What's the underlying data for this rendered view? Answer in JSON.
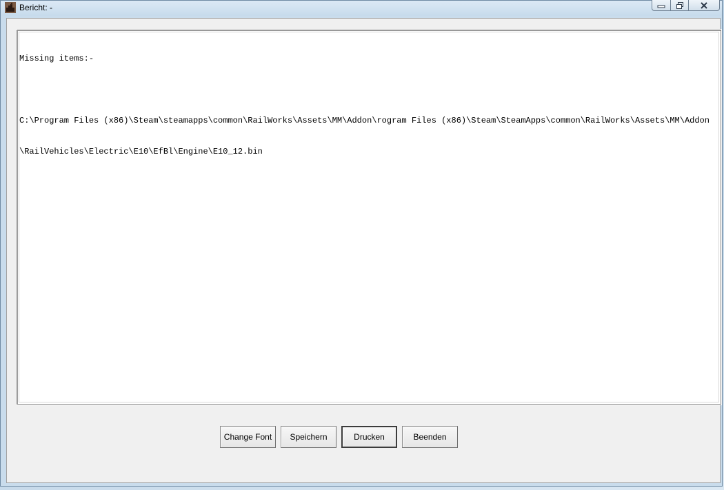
{
  "window": {
    "title": "Bericht: -",
    "icon": "app-icon",
    "controls": {
      "minimize": "minimize-icon",
      "maximize": "maximize-icon",
      "close": "close-icon"
    }
  },
  "report": {
    "lines": [
      "Missing items:-",
      "",
      "C:\\Program Files (x86)\\Steam\\steamapps\\common\\RailWorks\\Assets\\MM\\Addon\\rogram Files (x86)\\Steam\\SteamApps\\common\\RailWorks\\Assets\\MM\\Addon",
      "\\RailVehicles\\Electric\\E10\\EfBl\\Engine\\E10_12.bin"
    ]
  },
  "buttons": {
    "change_font": "Change Font",
    "save": "Speichern",
    "print": "Drucken",
    "exit": "Beenden"
  }
}
